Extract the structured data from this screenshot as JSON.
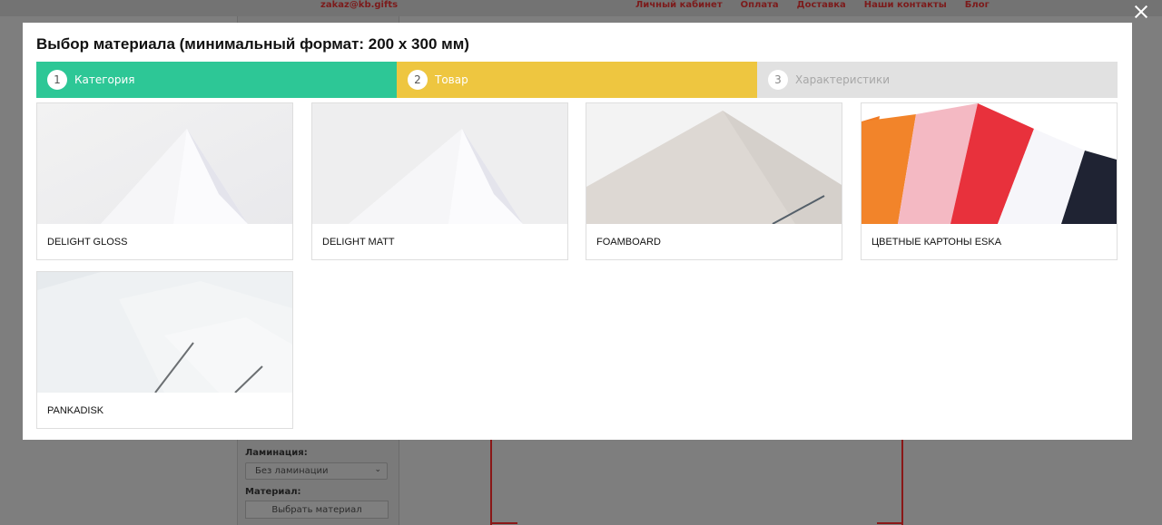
{
  "background": {
    "email": "zakaz@kb.gifts",
    "nav": [
      "Личный кабинет",
      "Оплата",
      "Доставка",
      "Наши контакты",
      "Блог"
    ],
    "lamination_label": "Ламинация:",
    "lamination_value": "Без ламинации",
    "material_label": "Материал:",
    "choose_material_button": "Выбрать материал"
  },
  "modal": {
    "title": "Выбор материала (минимальный формат: 200 х 300 мм)",
    "steps": [
      {
        "number": "1",
        "label": "Категория",
        "color": "#2dc796"
      },
      {
        "number": "2",
        "label": "Товар",
        "color": "#eec640"
      },
      {
        "number": "3",
        "label": "Характеристики",
        "color": "#e1e1e1"
      }
    ],
    "products": [
      {
        "name": "DELIGHT GLOSS",
        "image": "white-paper-sheets"
      },
      {
        "name": "DELIGHT MATT",
        "image": "white-paper-sheets"
      },
      {
        "name": "FOAMBOARD",
        "image": "grey-foam-board"
      },
      {
        "name": "ЦВЕТНЫЕ КАРТОНЫ ESKA",
        "image": "colored-cardboard-sheets"
      },
      {
        "name": "PANKADISK",
        "image": "white-textured-sheets"
      }
    ]
  }
}
